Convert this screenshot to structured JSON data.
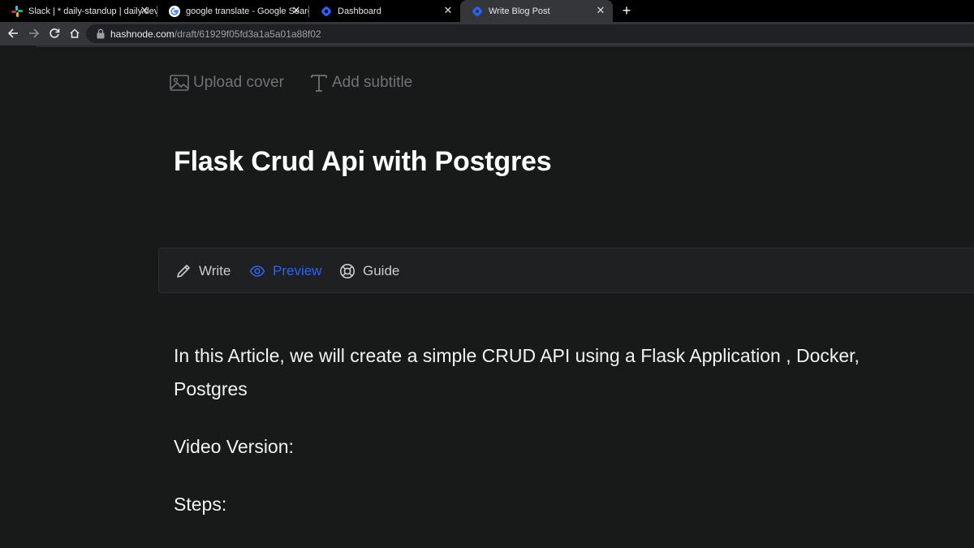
{
  "browser": {
    "tabs": [
      {
        "title": "Slack | * daily-standup | daily.dev",
        "icon": "slack-icon",
        "active": false
      },
      {
        "title": "google translate - Google Search",
        "icon": "google-icon",
        "active": false
      },
      {
        "title": "Dashboard",
        "icon": "hashnode-icon",
        "active": false
      },
      {
        "title": "Write Blog Post",
        "icon": "hashnode-icon",
        "active": true
      }
    ],
    "url_host": "hashnode.com",
    "url_path": "/draft/61929f05fd3a1a5a01a88f02"
  },
  "editor": {
    "upload_cover_label": "Upload cover",
    "add_subtitle_label": "Add subtitle",
    "title": "Flask Crud Api with Postgres",
    "modes": [
      {
        "label": "Write",
        "icon": "pencil-icon",
        "active": false
      },
      {
        "label": "Preview",
        "icon": "eye-icon",
        "active": true
      },
      {
        "label": "Guide",
        "icon": "lifebuoy-icon",
        "active": false
      }
    ],
    "paragraphs": [
      "In this Article, we will create a simple CRUD API using a Flask Application , Docker,",
      "Postgres",
      "Video Version:",
      "Steps:"
    ]
  },
  "colors": {
    "accent": "#2f62f0",
    "background": "#181919"
  }
}
